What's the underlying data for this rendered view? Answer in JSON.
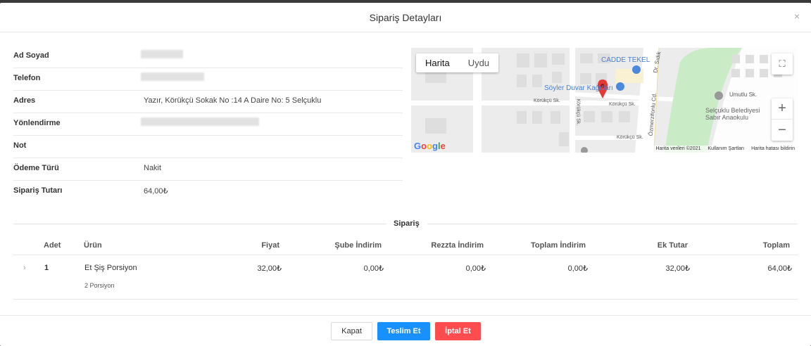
{
  "modal": {
    "title": "Sipariş Detayları",
    "close_icon": "×"
  },
  "info": {
    "rows": [
      {
        "label": "Ad Soyad",
        "value": ""
      },
      {
        "label": "Telefon",
        "value": ""
      },
      {
        "label": "Adres",
        "value": "Yazır, Körükçü Sokak No :14 A Daire No: 5 Selçuklu"
      },
      {
        "label": "Yönlendirme",
        "value": ""
      },
      {
        "label": "Not",
        "value": ""
      },
      {
        "label": "Ödeme Türü",
        "value": "Nakit"
      },
      {
        "label": "Sipariş Tutarı",
        "value": "64,00₺"
      }
    ]
  },
  "map": {
    "tabs": [
      "Harita",
      "Uydu"
    ],
    "active_tab": "Harita",
    "labels": {
      "place1": "CADDE TEKEL",
      "place2": "Söyler Duvar Kağıtları",
      "street1": "Körükçü Sk.",
      "street2": "Körükçü Sk.",
      "street3": "Körükçü Sk.",
      "street4": "Körükçü Sk.",
      "street5": "Özmerzifonlu Cd.",
      "street6": "Dr. Sıdık",
      "street7": "Umutlu Sk.",
      "place3": "Selçuklu Belediyesi Sabır Anaokulu",
      "google": "Google"
    },
    "footer": [
      "Harita verileri ©2021",
      "Kullanım Şartları",
      "Harita hatası bildirin"
    ],
    "zoom_in": "+",
    "zoom_out": "−",
    "fullscreen_icon": "⛶"
  },
  "order": {
    "section_title": "Sipariş",
    "columns": [
      "Adet",
      "Ürün",
      "Fiyat",
      "Şube İndirim",
      "Rezzta İndirim",
      "Toplam İndirim",
      "Ek Tutar",
      "Toplam"
    ],
    "rows": [
      {
        "adet": "1",
        "urun": "Et Şiş Porsiyon",
        "urun_detay": "2 Porsiyon",
        "fiyat": "32,00₺",
        "sube_indirim": "0,00₺",
        "rezzta_indirim": "0,00₺",
        "toplam_indirim": "0,00₺",
        "ek_tutar": "32,00₺",
        "toplam": "64,00₺"
      }
    ]
  },
  "footer": {
    "close_label": "Kapat",
    "deliver_label": "Teslim Et",
    "cancel_label": "İptal Et"
  }
}
